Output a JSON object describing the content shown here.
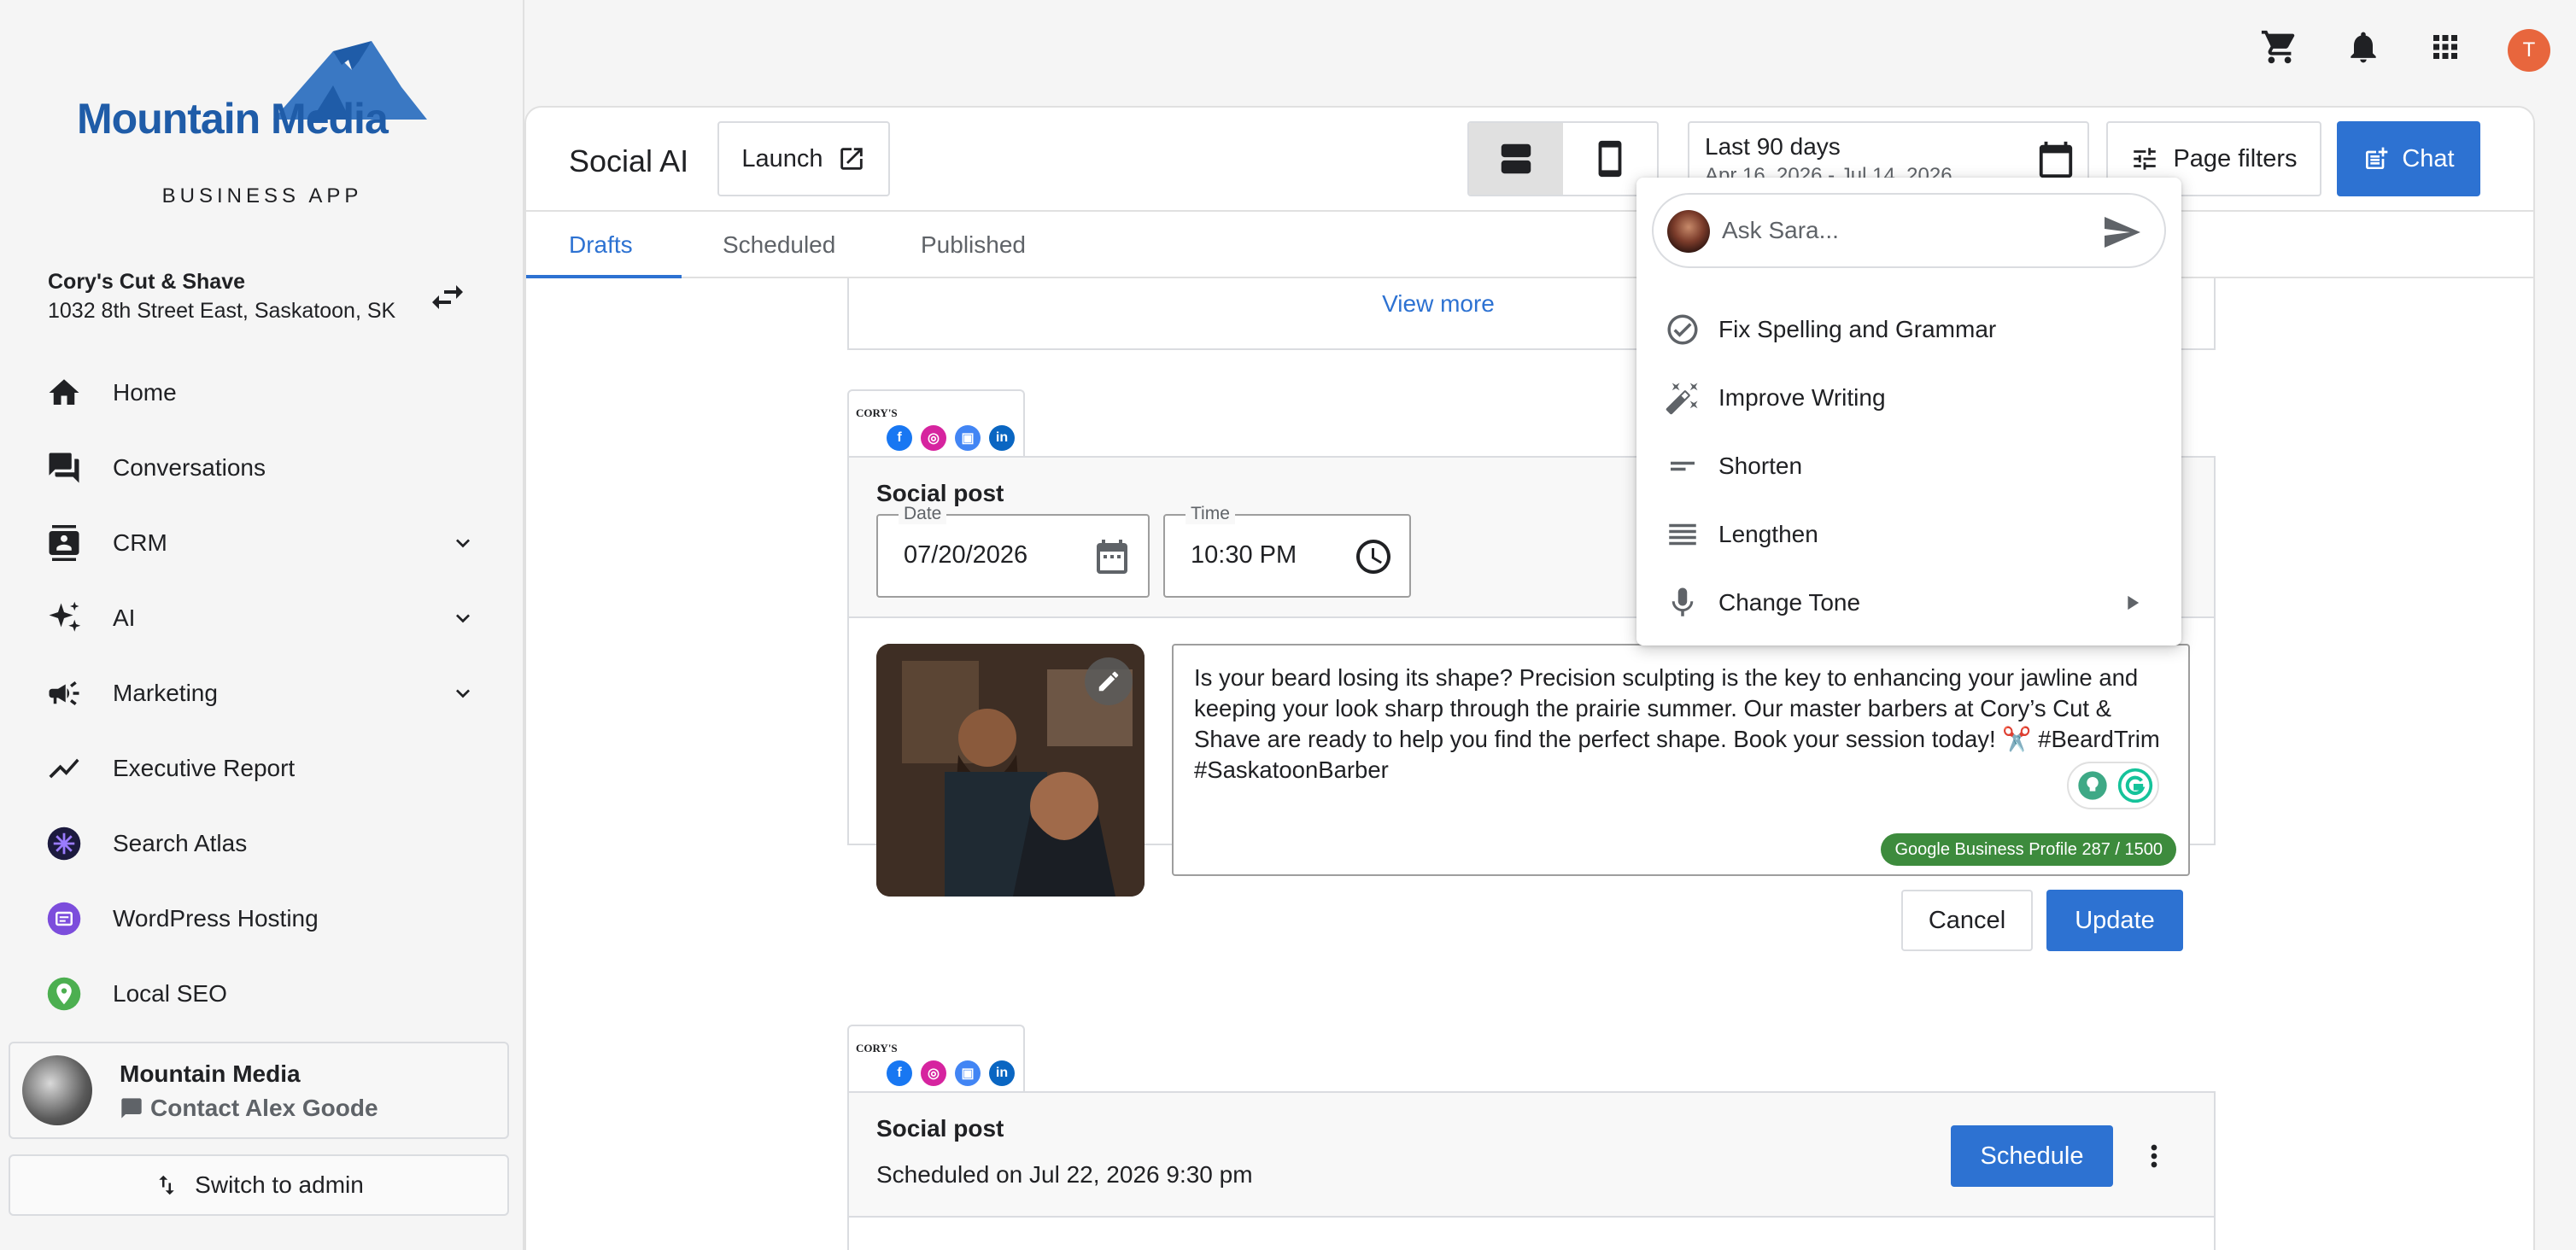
{
  "sidebar": {
    "logo_text": "Mountain Media",
    "subtitle": "BUSINESS APP",
    "business_name": "Cory's Cut & Shave",
    "business_address": "1032 8th Street East, Saskatoon, SK",
    "nav": [
      {
        "label": "Home",
        "icon": "home-icon"
      },
      {
        "label": "Conversations",
        "icon": "conversations-icon"
      },
      {
        "label": "CRM",
        "icon": "crm-icon",
        "expandable": true
      },
      {
        "label": "AI",
        "icon": "ai-sparkle-icon",
        "expandable": true
      },
      {
        "label": "Marketing",
        "icon": "megaphone-icon",
        "expandable": true
      },
      {
        "label": "Executive Report",
        "icon": "trend-icon"
      },
      {
        "label": "Search Atlas",
        "icon": "search-atlas-icon"
      },
      {
        "label": "WordPress Hosting",
        "icon": "wordpress-hosting-icon"
      },
      {
        "label": "Local SEO",
        "icon": "local-seo-icon"
      }
    ],
    "contact_card": {
      "name": "Mountain Media",
      "contact": "Contact Alex Goode"
    },
    "switch_admin": "Switch to admin"
  },
  "topbar": {
    "user_initial": "T"
  },
  "header": {
    "title": "Social AI",
    "launch_label": "Launch",
    "date_range_label": "Last 90 days",
    "date_range_sub": "Apr 16, 2026 - Jul 14, 2026",
    "page_filters_label": "Page filters",
    "chat_label": "Chat"
  },
  "tabs": [
    {
      "label": "Drafts",
      "active": true
    },
    {
      "label": "Scheduled",
      "active": false
    },
    {
      "label": "Published",
      "active": false
    }
  ],
  "content": {
    "view_more": "View more",
    "post1": {
      "title": "Social post",
      "date_label": "Date",
      "date_value": "07/20/2026",
      "time_label": "Time",
      "time_value": "10:30 PM",
      "text": "Is your beard losing its shape? Precision sculpting is the key to enhancing your jawline and keeping your look sharp through the prairie summer. Our master barbers at Cory’s Cut & Shave are ready to help you find the perfect shape. Book your session today! ✂️ #BeardTrim #SaskatoonBarber",
      "char_badge": "Google Business Profile 287 / 1500",
      "cancel_label": "Cancel",
      "update_label": "Update"
    },
    "post2": {
      "title": "Social post",
      "scheduled_text": "Scheduled on Jul 22, 2026 9:30 pm",
      "schedule_label": "Schedule"
    }
  },
  "ai_menu": {
    "ask_placeholder": "Ask Sara...",
    "items": [
      {
        "label": "Fix Spelling and Grammar",
        "icon": "check-circle-icon"
      },
      {
        "label": "Improve Writing",
        "icon": "magic-wand-icon"
      },
      {
        "label": "Shorten",
        "icon": "short-lines-icon"
      },
      {
        "label": "Lengthen",
        "icon": "long-lines-icon"
      },
      {
        "label": "Change Tone",
        "icon": "microphone-icon",
        "submenu": true
      }
    ]
  },
  "colors": {
    "accent": "#2d72d2",
    "brand": "#1f5ca8",
    "badge": "#3d8b3d",
    "avatar": "#e8663d"
  }
}
